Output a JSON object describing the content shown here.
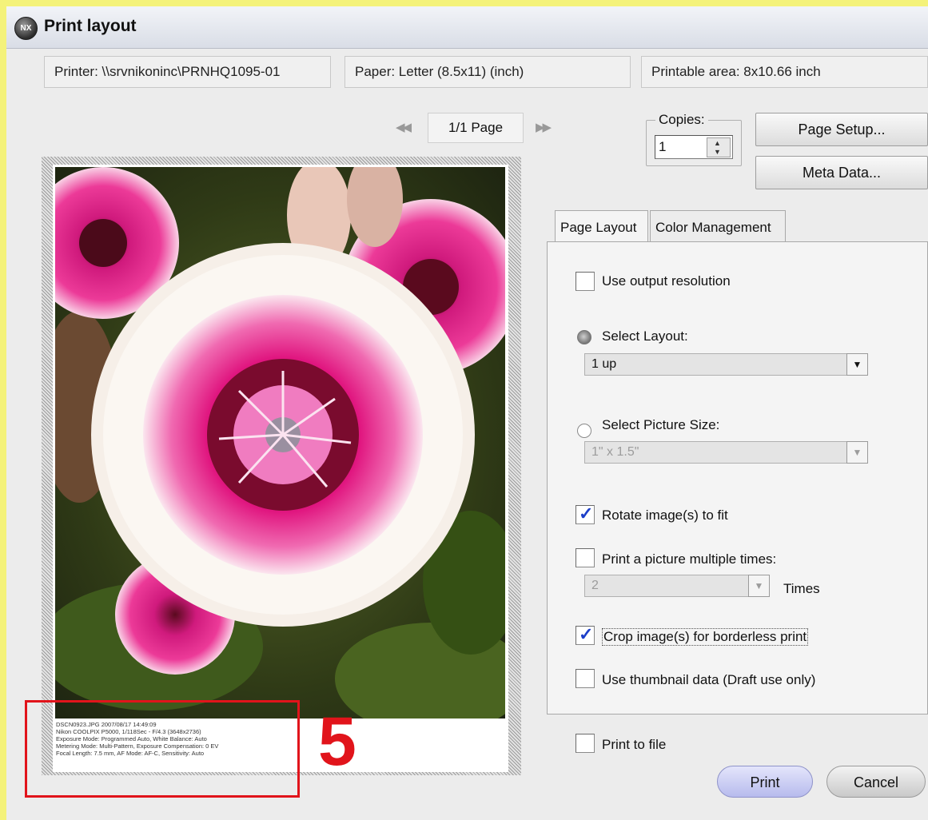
{
  "window": {
    "title": "Print layout",
    "logo_text": "NX"
  },
  "info": {
    "printer": "Printer:  \\\\srvnikoninc\\PRNHQ1095-01",
    "paper": "Paper:  Letter (8.5x11) (inch)",
    "printable": "Printable area:  8x10.66 inch"
  },
  "navigation": {
    "page_label": "1/1 Page",
    "prev_icon": "◀◀",
    "next_icon": "▶▶"
  },
  "copies": {
    "legend": "Copies:",
    "value": "1"
  },
  "buttons": {
    "page_setup": "Page Setup...",
    "meta_data": "Meta Data...",
    "print": "Print",
    "cancel": "Cancel"
  },
  "tabs": [
    {
      "label": "Page Layout",
      "active": true
    },
    {
      "label": "Color Management",
      "active": false
    }
  ],
  "options": {
    "use_output_resolution": {
      "label": "Use output resolution",
      "checked": false
    },
    "select_layout": {
      "label": "Select Layout:",
      "selected": true,
      "value": "1 up"
    },
    "select_picture_size": {
      "label": "Select Picture Size:",
      "selected": false,
      "value": "1\" x 1.5\""
    },
    "rotate_to_fit": {
      "label": "Rotate image(s) to fit",
      "checked": true
    },
    "print_multiple": {
      "label": "Print a picture multiple times:",
      "checked": false,
      "value": "2",
      "unit": "Times"
    },
    "crop_borderless": {
      "label": "Crop image(s) for borderless print",
      "checked": true
    },
    "use_thumbnail": {
      "label": "Use thumbnail data (Draft use only)",
      "checked": false
    },
    "print_to_file": {
      "label": "Print to file",
      "checked": false
    }
  },
  "preview": {
    "metadata_lines": [
      "DSCN0923.JPG 2007/08/17 14:49:09",
      "Nikon COOLPIX P5000, 1/118Sec - F/4.3 (3648x2736)",
      "Exposure Mode: Programmed Auto, White Balance: Auto",
      "Metering Mode: Multi-Pattern, Exposure Compensation: 0 EV",
      "Focal Length: 7.5 mm, AF Mode: AF-C, Sensitivity: Auto"
    ]
  },
  "annotation": {
    "number": "5"
  },
  "colors": {
    "accent_check": "#1d3fc9",
    "annotation_red": "#e1141b",
    "print_button": "#c7c9ef"
  }
}
